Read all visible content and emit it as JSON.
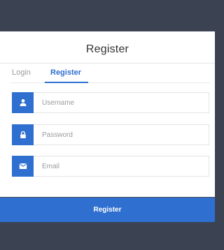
{
  "header": {
    "title": "Register"
  },
  "tabs": [
    {
      "label": "Login",
      "active": false
    },
    {
      "label": "Register",
      "active": true
    }
  ],
  "form": {
    "username": {
      "placeholder": "Username",
      "value": "",
      "icon": "user-icon"
    },
    "password": {
      "placeholder": "Password",
      "value": "",
      "icon": "lock-icon"
    },
    "email": {
      "placeholder": "Email",
      "value": "",
      "icon": "envelope-icon"
    }
  },
  "submit": {
    "label": "Register"
  },
  "colors": {
    "accent": "#2f6fcf",
    "frame": "#3b4352",
    "background": "#ffffff"
  }
}
